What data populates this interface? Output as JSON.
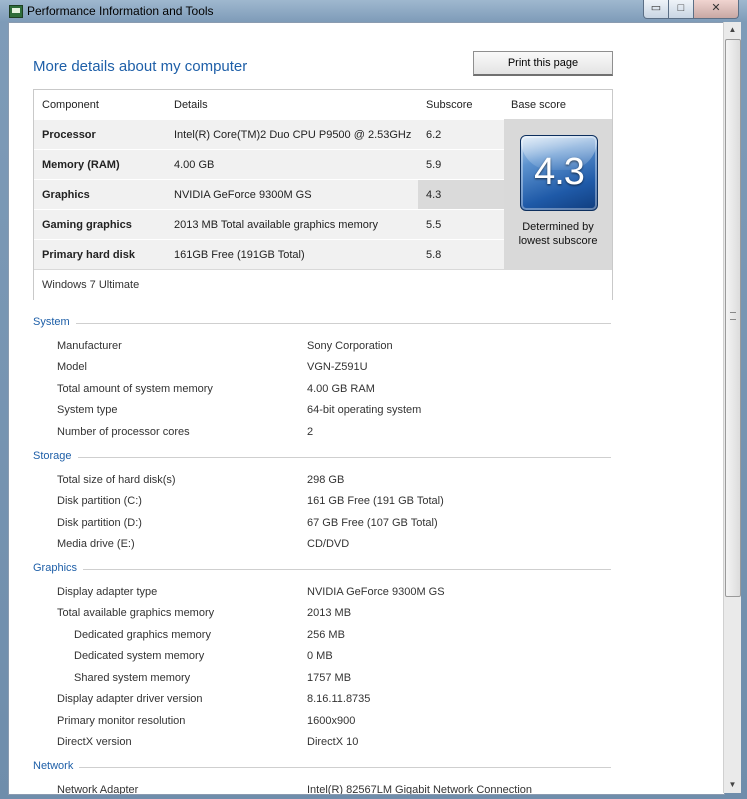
{
  "window": {
    "title": "Performance Information and Tools"
  },
  "controls": {
    "minimize": "▭",
    "maximize": "□",
    "close": "✕"
  },
  "page": {
    "title": "More details about my computer",
    "print_label": "Print this page"
  },
  "scores": {
    "headers": {
      "component": "Component",
      "details": "Details",
      "subscore": "Subscore",
      "base": "Base score"
    },
    "rows": [
      {
        "component": "Processor",
        "details": "Intel(R) Core(TM)2 Duo CPU P9500 @ 2.53GHz",
        "subscore": "6.2"
      },
      {
        "component": "Memory (RAM)",
        "details": "4.00 GB",
        "subscore": "5.9"
      },
      {
        "component": "Graphics",
        "details": "NVIDIA GeForce 9300M GS",
        "subscore": "4.3"
      },
      {
        "component": "Gaming graphics",
        "details": "2013 MB Total available graphics memory",
        "subscore": "5.5"
      },
      {
        "component": "Primary hard disk",
        "details": "161GB Free (191GB Total)",
        "subscore": "5.8"
      }
    ],
    "base_score": "4.3",
    "determined_line1": "Determined by",
    "determined_line2": "lowest subscore",
    "os": "Windows 7 Ultimate"
  },
  "system": {
    "title": "System",
    "items": [
      {
        "label": "Manufacturer",
        "value": "Sony Corporation"
      },
      {
        "label": "Model",
        "value": "VGN-Z591U"
      },
      {
        "label": "Total amount of system memory",
        "value": "4.00 GB RAM"
      },
      {
        "label": "System type",
        "value": "64-bit operating system"
      },
      {
        "label": "Number of processor cores",
        "value": "2"
      }
    ]
  },
  "storage": {
    "title": "Storage",
    "items": [
      {
        "label": "Total size of hard disk(s)",
        "value": "298 GB"
      },
      {
        "label": "Disk partition (C:)",
        "value": "161 GB Free (191 GB Total)"
      },
      {
        "label": "Disk partition (D:)",
        "value": "67 GB Free (107 GB Total)"
      },
      {
        "label": "Media drive (E:)",
        "value": "CD/DVD"
      }
    ]
  },
  "graphics": {
    "title": "Graphics",
    "items": [
      {
        "label": "Display adapter type",
        "value": "NVIDIA GeForce 9300M GS"
      },
      {
        "label": "Total available graphics memory",
        "value": "2013 MB"
      },
      {
        "label": "Dedicated graphics memory",
        "value": "256 MB"
      },
      {
        "label": "Dedicated system memory",
        "value": "0 MB"
      },
      {
        "label": "Shared system memory",
        "value": "1757 MB"
      },
      {
        "label": "Display adapter driver version",
        "value": "8.16.11.8735"
      },
      {
        "label": "Primary monitor resolution",
        "value": "1600x900"
      },
      {
        "label": "DirectX version",
        "value": "DirectX 10"
      }
    ]
  },
  "network": {
    "title": "Network",
    "items": [
      {
        "label": "Network Adapter",
        "value": "Intel(R) 82567LM Gigabit Network Connection"
      }
    ]
  }
}
